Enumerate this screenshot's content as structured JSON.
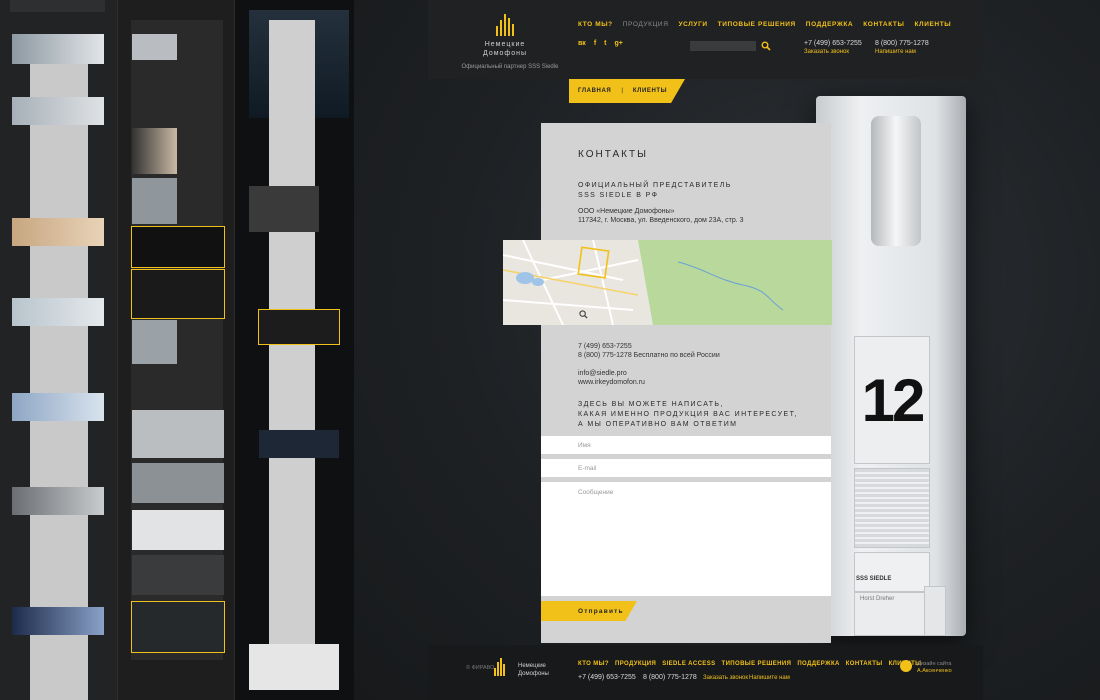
{
  "brand": {
    "name_line1": "Немецкие",
    "name_line2": "Домофоны",
    "partner": "Официальный партнер SSS Siedle"
  },
  "nav": [
    {
      "label": "Кто мы?",
      "current": false
    },
    {
      "label": "Продукция",
      "current": true
    },
    {
      "label": "Услуги",
      "current": false
    },
    {
      "label": "Типовые решения",
      "current": false
    },
    {
      "label": "Поддержка",
      "current": false
    },
    {
      "label": "Контакты",
      "current": false
    },
    {
      "label": "Клиенты",
      "current": false
    }
  ],
  "social": [
    "вк",
    "f",
    "t",
    "g+"
  ],
  "search": {
    "placeholder": ""
  },
  "header_contacts": {
    "phone1": "+7 (499) 653-7255",
    "phone1_link": "Заказать звонок",
    "phone2": "8 (800) 775-1278",
    "phone2_link": "Напишите нам"
  },
  "breadcrumbs": {
    "home": "Главная",
    "sep": "|",
    "current": "Клиенты"
  },
  "device": {
    "number": "12",
    "brand": "SSS SIEDLE",
    "nameplate": "Horst Dreher"
  },
  "card": {
    "title": "Контакты",
    "rep_line1": "Официальный представитель",
    "rep_line2": "SSS Siedle в РФ",
    "company": "ООО «Немецкие Домофоны»",
    "address": "117342, г. Москва, ул. Введенского, дом 23А, стр. 3",
    "phone1": "7 (499) 653-7255",
    "phone2": "8 (800) 775-1278 Бесплатно по всей России",
    "email": "info@siedle.pro",
    "site": "www.irkeydomofon.ru",
    "cta_line1": "Здесь вы можете написать,",
    "cta_line2": "какая именно продукция вас интересует,",
    "cta_line3": "а мы оперативно вам ответим",
    "name_placeholder": "Имя",
    "email_placeholder": "E-mail",
    "message_placeholder": "Сообщение",
    "submit": "Отправить"
  },
  "footer": {
    "copyright": "© ФИРАВО",
    "name_line1": "Немецкие",
    "name_line2": "Домофоны",
    "nav": [
      "Кто мы?",
      "Продукция",
      "Siedle Access",
      "Типовые решения",
      "Поддержка",
      "Контакты",
      "Клиенты"
    ],
    "phone1": "+7 (499) 653-7255",
    "phone2": "8 (800) 775-1278",
    "link1": "Заказать звонок",
    "link2": "Напишите нам",
    "designer_label": "Дизайн сайта",
    "designer_name": "А.Аксенченко"
  },
  "colors": {
    "accent": "#f2c119",
    "header_bg": "#202123",
    "card_bg": "#d3d3d3"
  }
}
